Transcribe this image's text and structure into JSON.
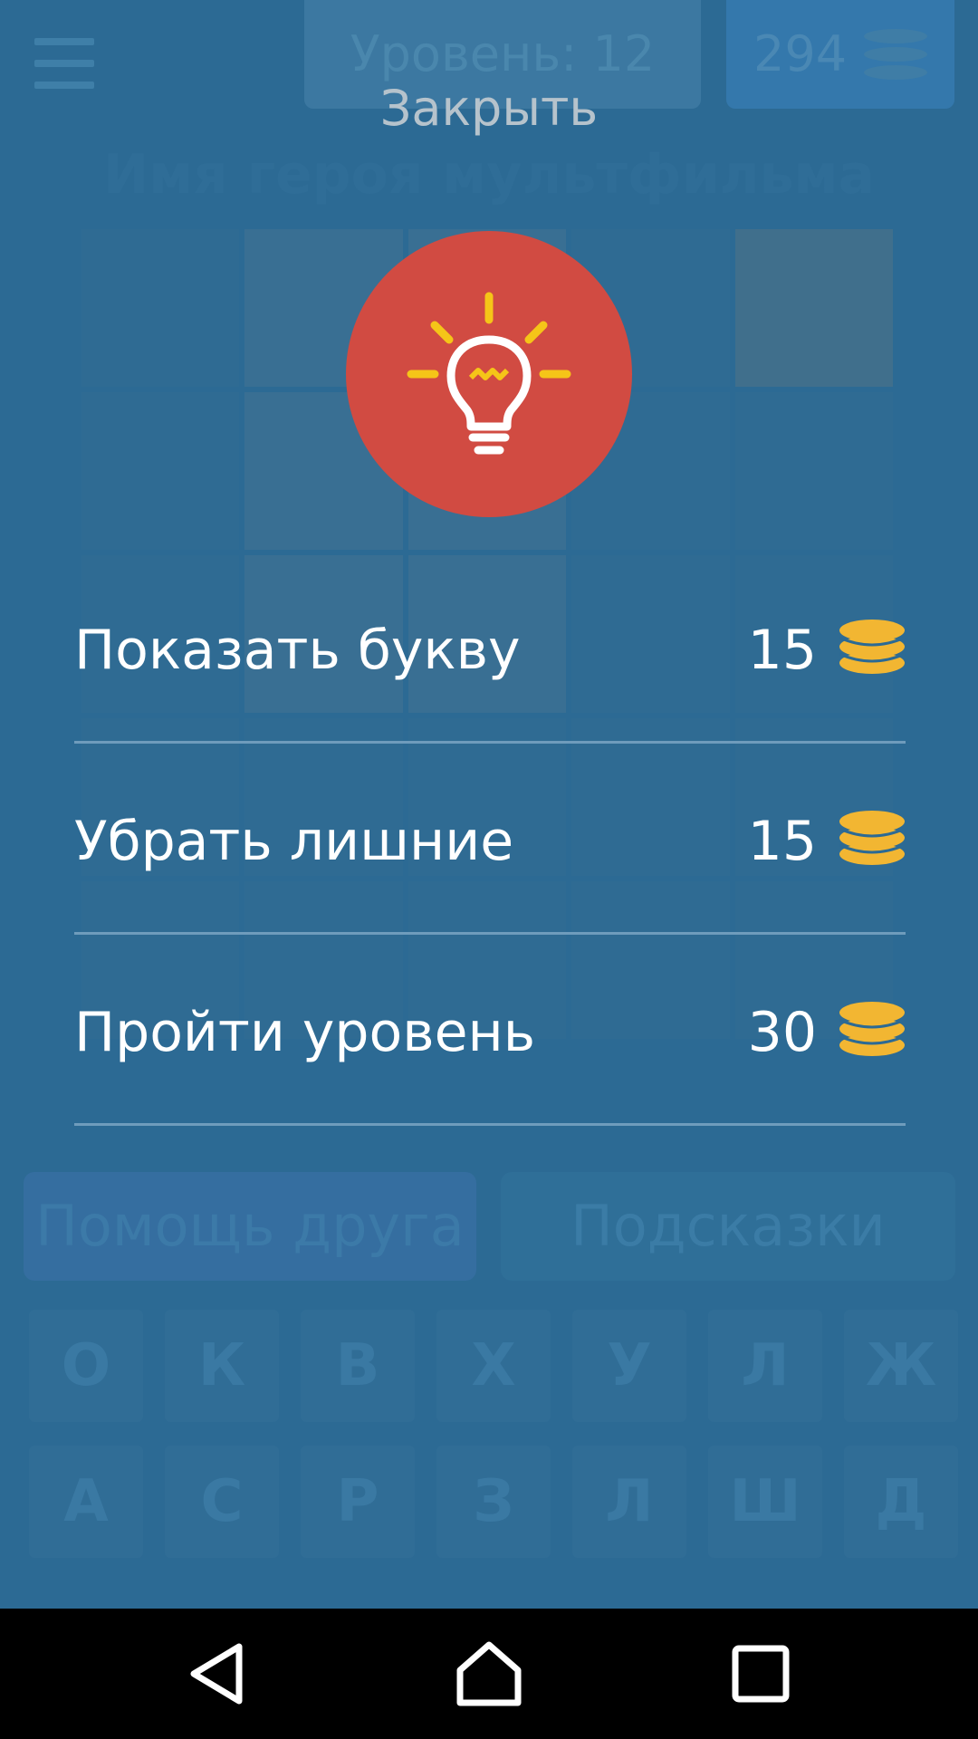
{
  "background": {
    "level_label": "Уровень: 12",
    "coins": "294",
    "category_title": "Имя героя мультфильма",
    "friend_help_label": "Помощь друга",
    "hints_label": "Подсказки",
    "keyboard_rows": [
      [
        "О",
        "К",
        "В",
        "Х",
        "У",
        "Л",
        "Ж"
      ],
      [
        "А",
        "С",
        "Р",
        "З",
        "Л",
        "Ш",
        "Д"
      ]
    ]
  },
  "overlay": {
    "close_label": "Закрыть",
    "icon": "lightbulb-icon",
    "hints": [
      {
        "label": "Показать букву",
        "price": "15"
      },
      {
        "label": "Убрать лишние",
        "price": "15"
      },
      {
        "label": "Пройти уровень",
        "price": "30"
      }
    ]
  },
  "nav_bar": {
    "icons": [
      "back-icon",
      "home-icon",
      "recents-icon"
    ]
  },
  "colors": {
    "overlay_bg": "#2c6a94",
    "bulb_circle": "#d14b42",
    "bulb_rays": "#f5c518",
    "coins": "#f2b632",
    "divider": "#6f9cbc"
  }
}
